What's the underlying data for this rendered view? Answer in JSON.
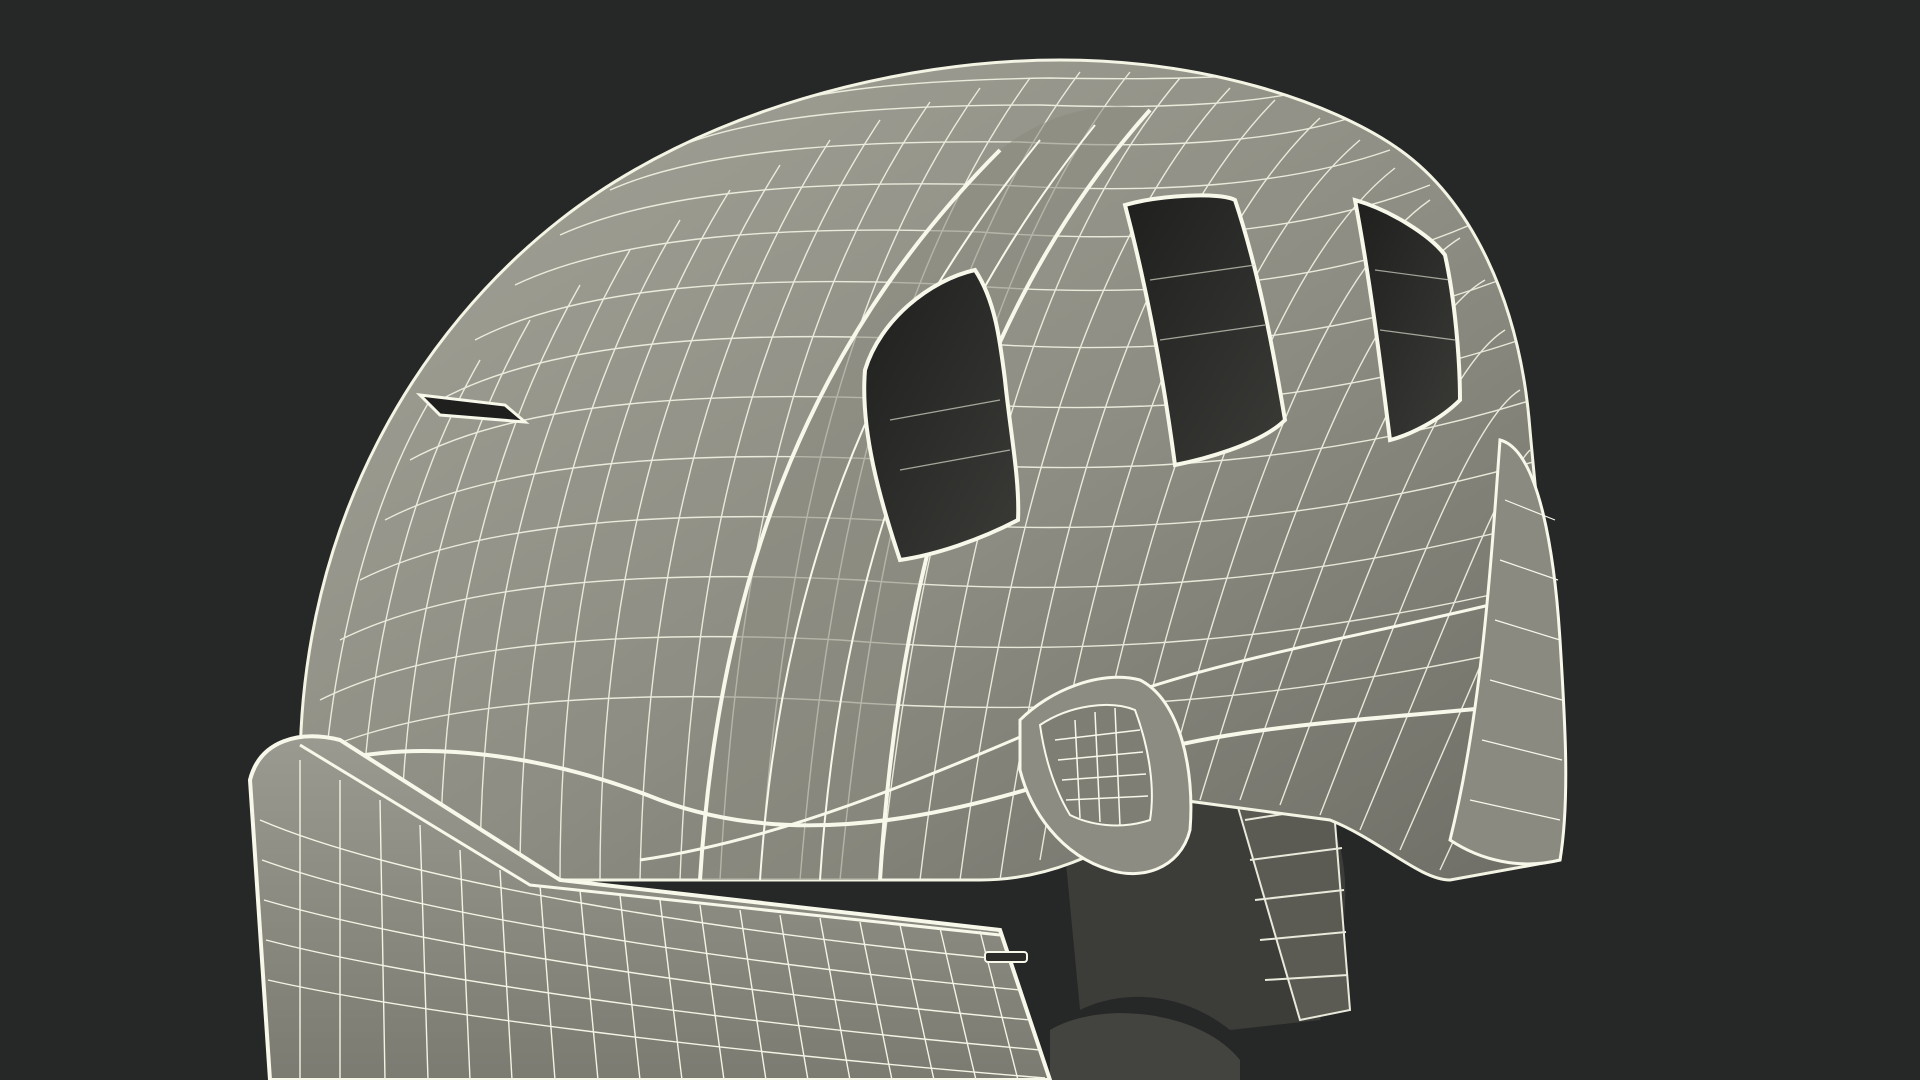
{
  "scene": {
    "subject": "helmet-wireframe-render",
    "background_color": "#262727",
    "shell_color": "#8f8f85",
    "shell_shadow_color": "#6f6f66",
    "wire_color": "#f3f4e4",
    "vent_color": "#2c2d2a"
  }
}
